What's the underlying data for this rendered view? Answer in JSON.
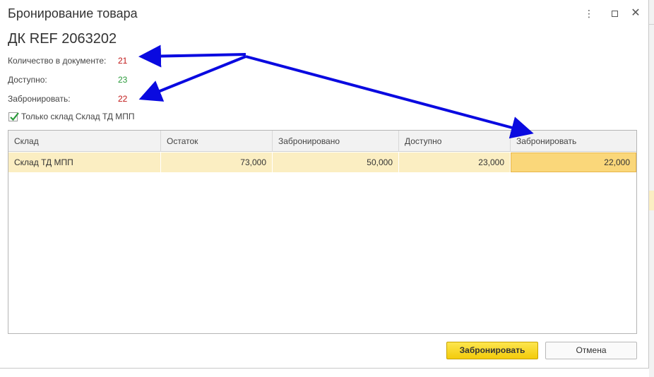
{
  "window": {
    "title": "Бронирование товара",
    "menu_glyph": "⋮",
    "close_glyph": "✕"
  },
  "item": {
    "code": "ДК REF 2063202"
  },
  "info": {
    "qty_label": "Количество в документе:",
    "qty_value": "21",
    "available_label": "Доступно:",
    "available_value": "23",
    "reserve_label": "Забронировать:",
    "reserve_value": "22"
  },
  "filter": {
    "checked": true,
    "label": "Только склад Склад ТД МПП"
  },
  "table": {
    "columns": [
      "Склад",
      "Остаток",
      "Забронировано",
      "Доступно",
      "Забронировать"
    ],
    "rows": [
      [
        "Склад ТД МПП",
        "73,000",
        "50,000",
        "23,000",
        "22,000"
      ]
    ]
  },
  "buttons": {
    "reserve": "Забронировать",
    "cancel": "Отмена"
  },
  "colors": {
    "accent_red": "#c01818",
    "accent_green": "#2a9a3a",
    "row_highlight": "#fbeec2",
    "primary_button": "#f3cb0b",
    "annotation_arrow": "#0a0ae0"
  }
}
